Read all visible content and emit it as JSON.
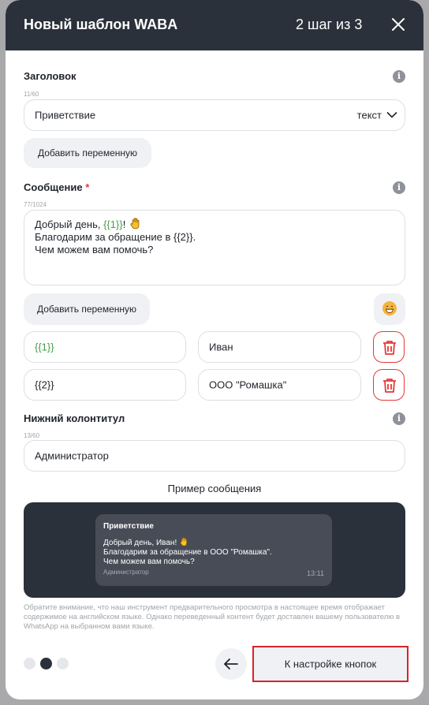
{
  "modal": {
    "title": "Новый шаблон WABA",
    "step": "2 шаг из 3"
  },
  "header_section": {
    "label": "Заголовок",
    "counter": "11/60",
    "value": "Приветствие",
    "type_value": "текст",
    "add_variable": "Добавить переменную"
  },
  "message_section": {
    "label": "Сообщение",
    "required_mark": "*",
    "counter": "77/1024",
    "line1_prefix": "Добрый день, ",
    "line1_var": "{{1}}",
    "line1_suffix": "!",
    "line2": "Благодарим за обращение в {{2}}.",
    "line3": "Чем можем вам помочь?",
    "add_variable": "Добавить переменную"
  },
  "variables": [
    {
      "name": "{{1}}",
      "value": "Иван",
      "name_color": "#43a047"
    },
    {
      "name": "{{2}}",
      "value": "ООО \"Ромашка\"",
      "name_color": "#1f232a"
    }
  ],
  "footer_section": {
    "label": "Нижний колонтитул",
    "counter": "13/60",
    "value": "Администратор"
  },
  "preview": {
    "title": "Пример сообщения",
    "bubble_header": "Приветствие",
    "bubble_line1": "Добрый день, Иван!",
    "bubble_line2": "Благодарим за обращение в ООО \"Ромашка\".",
    "bubble_line3": "Чем можем вам помочь?",
    "bubble_footer": "Администратор",
    "bubble_time": "13:11",
    "note": "Обратите внимание, что наш инструмент предварительного просмотра в настоящее время отображает содержимое на английском языке. Однако переведенный контент будет доставлен вашему пользователю в WhatsApp на выбранном вами языке."
  },
  "navigation": {
    "steps_total": 3,
    "current_step": 2,
    "next_label": "К настройке кнопок",
    "back_icon": "arrow-left-icon"
  },
  "icons": {
    "close": "close-icon",
    "info": "info-icon",
    "chevron": "chevron-down-icon",
    "trash": "trash-icon",
    "emoji": "emoji-icon",
    "wave": "waving-hand-icon"
  },
  "colors": {
    "header_bg": "#2b313b",
    "accent_red": "#e53935",
    "variable_green": "#43a047"
  }
}
